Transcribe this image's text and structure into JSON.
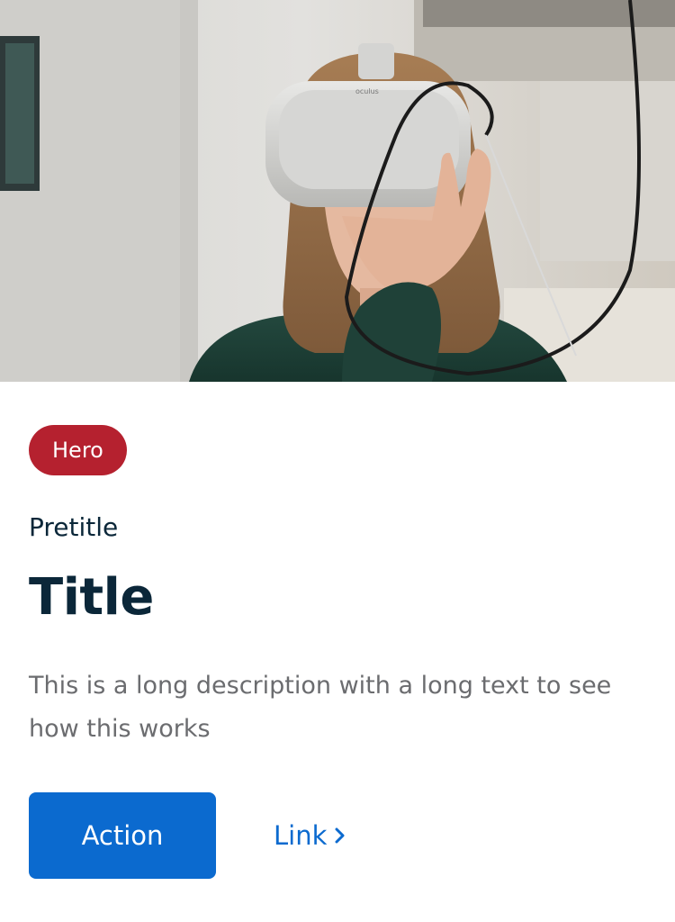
{
  "hero": {
    "image_alt": "Person wearing a VR headset",
    "headset_brand": "oculus"
  },
  "card": {
    "tag": "Hero",
    "pretitle": "Pretitle",
    "title": "Title",
    "description": "This is a long description with a long text to see how this works",
    "action_label": "Action",
    "link_label": "Link"
  },
  "colors": {
    "tag_bg": "#b5212f",
    "primary": "#0b6acf",
    "text_main": "#0b2739",
    "text_secondary": "#6b6c6f"
  },
  "icons": {
    "link_chevron": "chevron-right-icon"
  }
}
